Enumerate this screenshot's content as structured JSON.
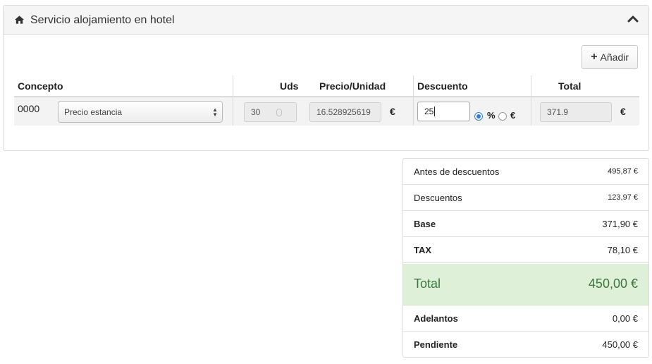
{
  "panel": {
    "title": "Servicio alojamiento en hotel",
    "icon": "home-icon",
    "collapse_icon": "chevron-up-icon",
    "add_button": {
      "icon": "plus-icon",
      "label": "Añadir"
    }
  },
  "table": {
    "headers": {
      "concepto": "Concepto",
      "uds": "Uds",
      "precio_unidad": "Precio/Unidad",
      "descuento": "Descuento",
      "total": "Total"
    },
    "row": {
      "code": "0000",
      "concepto_selected": "Precio estancia",
      "uds": "30",
      "precio_unidad": "16.528925619",
      "currency_symbol": "€",
      "descuento": "25",
      "discount_type_percent": "%",
      "discount_type_euro": "€",
      "discount_type_selected": "percent",
      "total": "371.9"
    }
  },
  "summary": {
    "antes_label": "Antes de descuentos",
    "antes_value": "495,87 €",
    "descuentos_label": "Descuentos",
    "descuentos_value": "123,97 €",
    "base_label": "Base",
    "base_value": "371,90 €",
    "tax_label": "TAX",
    "tax_value": "78,10 €",
    "total_label": "Total",
    "total_value": "450,00 €",
    "adelantos_label": "Adelantos",
    "adelantos_value": "0,00 €",
    "pendiente_label": "Pendiente",
    "pendiente_value": "450,00 €"
  },
  "colors": {
    "total_bg": "#dff0d8",
    "total_text": "#3c763d",
    "radio_accent": "#2f7de1"
  }
}
